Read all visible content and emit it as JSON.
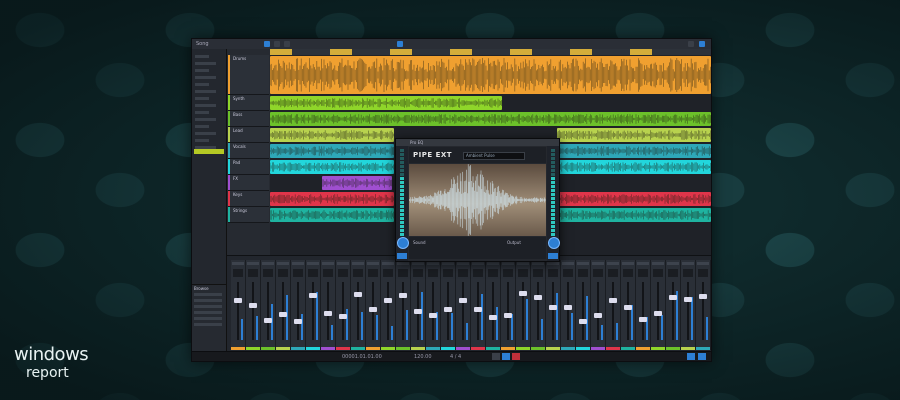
{
  "brand": {
    "line1": "windows",
    "line2": "report"
  },
  "window": {
    "title": "Song",
    "plugin_title": "Pro EQ",
    "plugin_brand": "PIPE EXT",
    "plugin_preset": "Ambient Pulse",
    "plugin_ctrl_left": "Sound",
    "plugin_ctrl_right": "Output"
  },
  "transport": {
    "position": "00001.01.01.00",
    "tempo": "120.00",
    "signature": "4 / 4"
  },
  "browser": {
    "title": "Browse"
  },
  "tracks": [
    {
      "name": "Drums",
      "color": "#f0a030",
      "height": 40
    },
    {
      "name": "Synth",
      "color": "#8fd62a",
      "height": 16
    },
    {
      "name": "Bass",
      "color": "#6cc12a",
      "height": 16
    },
    {
      "name": "Lead",
      "color": "#b8d24e",
      "height": 16
    },
    {
      "name": "Vocals",
      "color": "#2ea8b8",
      "height": 16
    },
    {
      "name": "Pad",
      "color": "#22d6dc",
      "height": 16
    },
    {
      "name": "FX",
      "color": "#a04fd0",
      "height": 16
    },
    {
      "name": "Keys",
      "color": "#e0354a",
      "height": 16
    },
    {
      "name": "Strings",
      "color": "#1fb3a0",
      "height": 16
    }
  ],
  "colors": {
    "accent": "#2d7fd4",
    "meter": "#2ec8c0",
    "lime": "#b5c924"
  },
  "icons": {
    "play": "play-icon",
    "stop": "stop-icon",
    "record": "record-icon",
    "settings": "gear-icon"
  }
}
